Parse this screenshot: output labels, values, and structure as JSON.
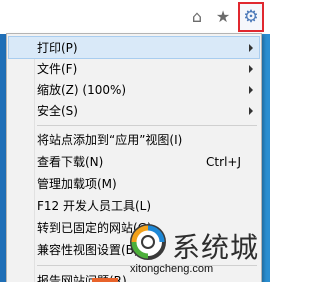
{
  "toolbar": {
    "home": "⌂",
    "favorites": "★",
    "tools": "⚙"
  },
  "menu": {
    "print": "打印(P)",
    "file": "文件(F)",
    "zoom": "缩放(Z) (100%)",
    "safety": "安全(S)",
    "add_to_apps": "将站点添加到“应用”视图(I)",
    "downloads": "查看下载(N)",
    "downloads_shortcut": "Ctrl+J",
    "manage_addons": "管理加载项(M)",
    "dev_tools": "F12 开发人员工具(L)",
    "pinned_sites": "转到已固定的网站(G)",
    "compat_view": "兼容性视图设置(B)",
    "report_problems": "报告网站问题(R)"
  },
  "watermark": {
    "title": "系统城",
    "url": "xitongcheng.com"
  }
}
